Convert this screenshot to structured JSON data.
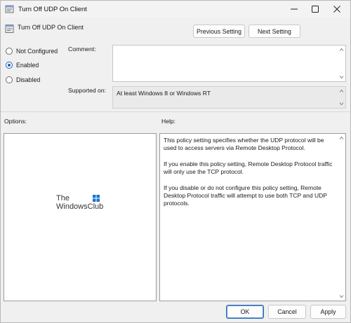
{
  "window": {
    "title": "Turn Off UDP On Client",
    "icon": "policy-icon",
    "controls": [
      "minimize-icon",
      "maximize-icon",
      "close-icon"
    ]
  },
  "header": {
    "policy_name": "Turn Off UDP On Client",
    "prev_label": "Previous Setting",
    "next_label": "Next Setting"
  },
  "state": {
    "options": [
      {
        "label": "Not Configured",
        "checked": false
      },
      {
        "label": "Enabled",
        "checked": true
      },
      {
        "label": "Disabled",
        "checked": false
      }
    ]
  },
  "comment": {
    "label": "Comment:",
    "value": ""
  },
  "supported": {
    "label": "Supported on:",
    "value": "At least Windows 8 or Windows RT"
  },
  "options_pane": {
    "label": "Options:",
    "watermark_line1": "The",
    "watermark_line2": "WindowsClub"
  },
  "help_pane": {
    "label": "Help:",
    "paragraphs": [
      "This policy setting specifies whether the UDP protocol will be used to access servers via Remote Desktop Protocol.",
      "If you enable this policy setting, Remote Desktop Protocol traffic will only use the TCP protocol.",
      "If you disable or do not configure this policy setting, Remote Desktop Protocol traffic will attempt to use both TCP and UDP protocols."
    ]
  },
  "footer": {
    "ok_label": "OK",
    "cancel_label": "Cancel",
    "apply_label": "Apply"
  },
  "colors": {
    "accent": "#1f5fb7",
    "window_bg": "#f0f0f0",
    "pane_bg": "#ffffff"
  }
}
